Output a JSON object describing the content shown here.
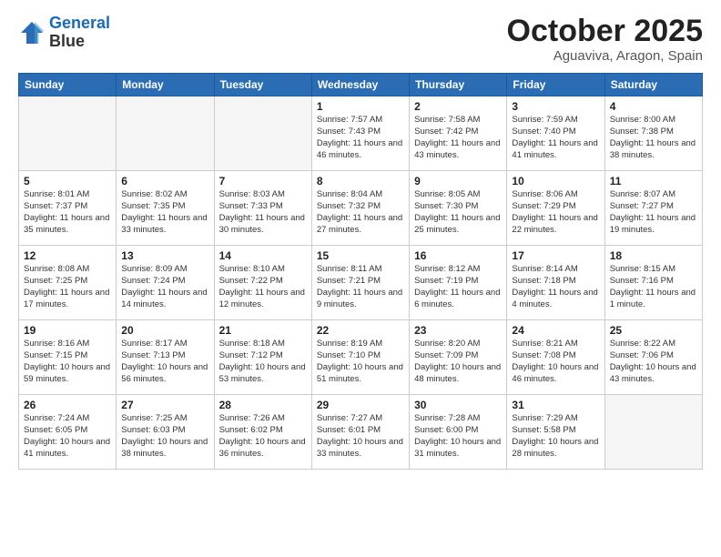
{
  "logo": {
    "line1": "General",
    "line2": "Blue"
  },
  "title": "October 2025",
  "subtitle": "Aguaviva, Aragon, Spain",
  "weekdays": [
    "Sunday",
    "Monday",
    "Tuesday",
    "Wednesday",
    "Thursday",
    "Friday",
    "Saturday"
  ],
  "weeks": [
    [
      {
        "day": "",
        "sunrise": "",
        "sunset": "",
        "daylight": ""
      },
      {
        "day": "",
        "sunrise": "",
        "sunset": "",
        "daylight": ""
      },
      {
        "day": "",
        "sunrise": "",
        "sunset": "",
        "daylight": ""
      },
      {
        "day": "1",
        "sunrise": "Sunrise: 7:57 AM",
        "sunset": "Sunset: 7:43 PM",
        "daylight": "Daylight: 11 hours and 46 minutes."
      },
      {
        "day": "2",
        "sunrise": "Sunrise: 7:58 AM",
        "sunset": "Sunset: 7:42 PM",
        "daylight": "Daylight: 11 hours and 43 minutes."
      },
      {
        "day": "3",
        "sunrise": "Sunrise: 7:59 AM",
        "sunset": "Sunset: 7:40 PM",
        "daylight": "Daylight: 11 hours and 41 minutes."
      },
      {
        "day": "4",
        "sunrise": "Sunrise: 8:00 AM",
        "sunset": "Sunset: 7:38 PM",
        "daylight": "Daylight: 11 hours and 38 minutes."
      }
    ],
    [
      {
        "day": "5",
        "sunrise": "Sunrise: 8:01 AM",
        "sunset": "Sunset: 7:37 PM",
        "daylight": "Daylight: 11 hours and 35 minutes."
      },
      {
        "day": "6",
        "sunrise": "Sunrise: 8:02 AM",
        "sunset": "Sunset: 7:35 PM",
        "daylight": "Daylight: 11 hours and 33 minutes."
      },
      {
        "day": "7",
        "sunrise": "Sunrise: 8:03 AM",
        "sunset": "Sunset: 7:33 PM",
        "daylight": "Daylight: 11 hours and 30 minutes."
      },
      {
        "day": "8",
        "sunrise": "Sunrise: 8:04 AM",
        "sunset": "Sunset: 7:32 PM",
        "daylight": "Daylight: 11 hours and 27 minutes."
      },
      {
        "day": "9",
        "sunrise": "Sunrise: 8:05 AM",
        "sunset": "Sunset: 7:30 PM",
        "daylight": "Daylight: 11 hours and 25 minutes."
      },
      {
        "day": "10",
        "sunrise": "Sunrise: 8:06 AM",
        "sunset": "Sunset: 7:29 PM",
        "daylight": "Daylight: 11 hours and 22 minutes."
      },
      {
        "day": "11",
        "sunrise": "Sunrise: 8:07 AM",
        "sunset": "Sunset: 7:27 PM",
        "daylight": "Daylight: 11 hours and 19 minutes."
      }
    ],
    [
      {
        "day": "12",
        "sunrise": "Sunrise: 8:08 AM",
        "sunset": "Sunset: 7:25 PM",
        "daylight": "Daylight: 11 hours and 17 minutes."
      },
      {
        "day": "13",
        "sunrise": "Sunrise: 8:09 AM",
        "sunset": "Sunset: 7:24 PM",
        "daylight": "Daylight: 11 hours and 14 minutes."
      },
      {
        "day": "14",
        "sunrise": "Sunrise: 8:10 AM",
        "sunset": "Sunset: 7:22 PM",
        "daylight": "Daylight: 11 hours and 12 minutes."
      },
      {
        "day": "15",
        "sunrise": "Sunrise: 8:11 AM",
        "sunset": "Sunset: 7:21 PM",
        "daylight": "Daylight: 11 hours and 9 minutes."
      },
      {
        "day": "16",
        "sunrise": "Sunrise: 8:12 AM",
        "sunset": "Sunset: 7:19 PM",
        "daylight": "Daylight: 11 hours and 6 minutes."
      },
      {
        "day": "17",
        "sunrise": "Sunrise: 8:14 AM",
        "sunset": "Sunset: 7:18 PM",
        "daylight": "Daylight: 11 hours and 4 minutes."
      },
      {
        "day": "18",
        "sunrise": "Sunrise: 8:15 AM",
        "sunset": "Sunset: 7:16 PM",
        "daylight": "Daylight: 11 hours and 1 minute."
      }
    ],
    [
      {
        "day": "19",
        "sunrise": "Sunrise: 8:16 AM",
        "sunset": "Sunset: 7:15 PM",
        "daylight": "Daylight: 10 hours and 59 minutes."
      },
      {
        "day": "20",
        "sunrise": "Sunrise: 8:17 AM",
        "sunset": "Sunset: 7:13 PM",
        "daylight": "Daylight: 10 hours and 56 minutes."
      },
      {
        "day": "21",
        "sunrise": "Sunrise: 8:18 AM",
        "sunset": "Sunset: 7:12 PM",
        "daylight": "Daylight: 10 hours and 53 minutes."
      },
      {
        "day": "22",
        "sunrise": "Sunrise: 8:19 AM",
        "sunset": "Sunset: 7:10 PM",
        "daylight": "Daylight: 10 hours and 51 minutes."
      },
      {
        "day": "23",
        "sunrise": "Sunrise: 8:20 AM",
        "sunset": "Sunset: 7:09 PM",
        "daylight": "Daylight: 10 hours and 48 minutes."
      },
      {
        "day": "24",
        "sunrise": "Sunrise: 8:21 AM",
        "sunset": "Sunset: 7:08 PM",
        "daylight": "Daylight: 10 hours and 46 minutes."
      },
      {
        "day": "25",
        "sunrise": "Sunrise: 8:22 AM",
        "sunset": "Sunset: 7:06 PM",
        "daylight": "Daylight: 10 hours and 43 minutes."
      }
    ],
    [
      {
        "day": "26",
        "sunrise": "Sunrise: 7:24 AM",
        "sunset": "Sunset: 6:05 PM",
        "daylight": "Daylight: 10 hours and 41 minutes."
      },
      {
        "day": "27",
        "sunrise": "Sunrise: 7:25 AM",
        "sunset": "Sunset: 6:03 PM",
        "daylight": "Daylight: 10 hours and 38 minutes."
      },
      {
        "day": "28",
        "sunrise": "Sunrise: 7:26 AM",
        "sunset": "Sunset: 6:02 PM",
        "daylight": "Daylight: 10 hours and 36 minutes."
      },
      {
        "day": "29",
        "sunrise": "Sunrise: 7:27 AM",
        "sunset": "Sunset: 6:01 PM",
        "daylight": "Daylight: 10 hours and 33 minutes."
      },
      {
        "day": "30",
        "sunrise": "Sunrise: 7:28 AM",
        "sunset": "Sunset: 6:00 PM",
        "daylight": "Daylight: 10 hours and 31 minutes."
      },
      {
        "day": "31",
        "sunrise": "Sunrise: 7:29 AM",
        "sunset": "Sunset: 5:58 PM",
        "daylight": "Daylight: 10 hours and 28 minutes."
      },
      {
        "day": "",
        "sunrise": "",
        "sunset": "",
        "daylight": ""
      }
    ]
  ]
}
